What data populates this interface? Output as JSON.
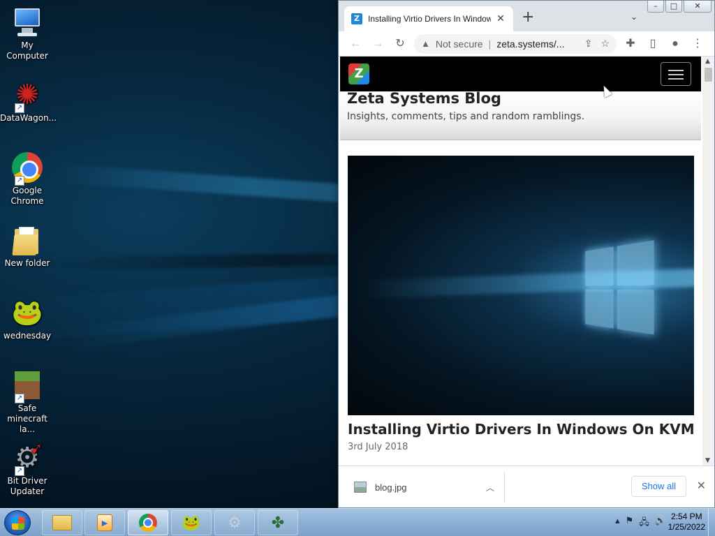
{
  "desktop": {
    "icons": [
      {
        "label": "My Computer",
        "icon": "computer-icon"
      },
      {
        "label": "DataWagon...",
        "icon": "datawagon-icon"
      },
      {
        "label": "Google Chrome",
        "icon": "chrome-icon"
      },
      {
        "label": "New folder",
        "icon": "folder-icon"
      },
      {
        "label": "wednesday",
        "icon": "frog-icon"
      },
      {
        "label": "Safe minecraft la...",
        "icon": "minecraft-icon"
      },
      {
        "label": "Bit Driver Updater",
        "icon": "gear-icon"
      }
    ]
  },
  "browser": {
    "tab_title": "Installing Virtio Drivers In Windows",
    "tab_favicon": "Z",
    "new_tab": "+",
    "omnibox": {
      "security": "Not secure",
      "url": "zeta.systems/..."
    },
    "page": {
      "logo": "Z",
      "blog_title": "Zeta Systems Blog",
      "tagline": "Insights, comments, tips and random ramblings.",
      "post_title": "Installing Virtio Drivers In Windows On KVM",
      "post_date": "3rd July 2018"
    },
    "download_bar": {
      "file_name": "blog.jpg",
      "show_all": "Show all"
    }
  },
  "taskbar": {
    "clock_time": "2:54 PM",
    "clock_date": "1/25/2022"
  },
  "colors": {
    "accent_blue": "#1a73e8",
    "taskbar": "#8eb1d6",
    "site_nav": "#000000"
  }
}
